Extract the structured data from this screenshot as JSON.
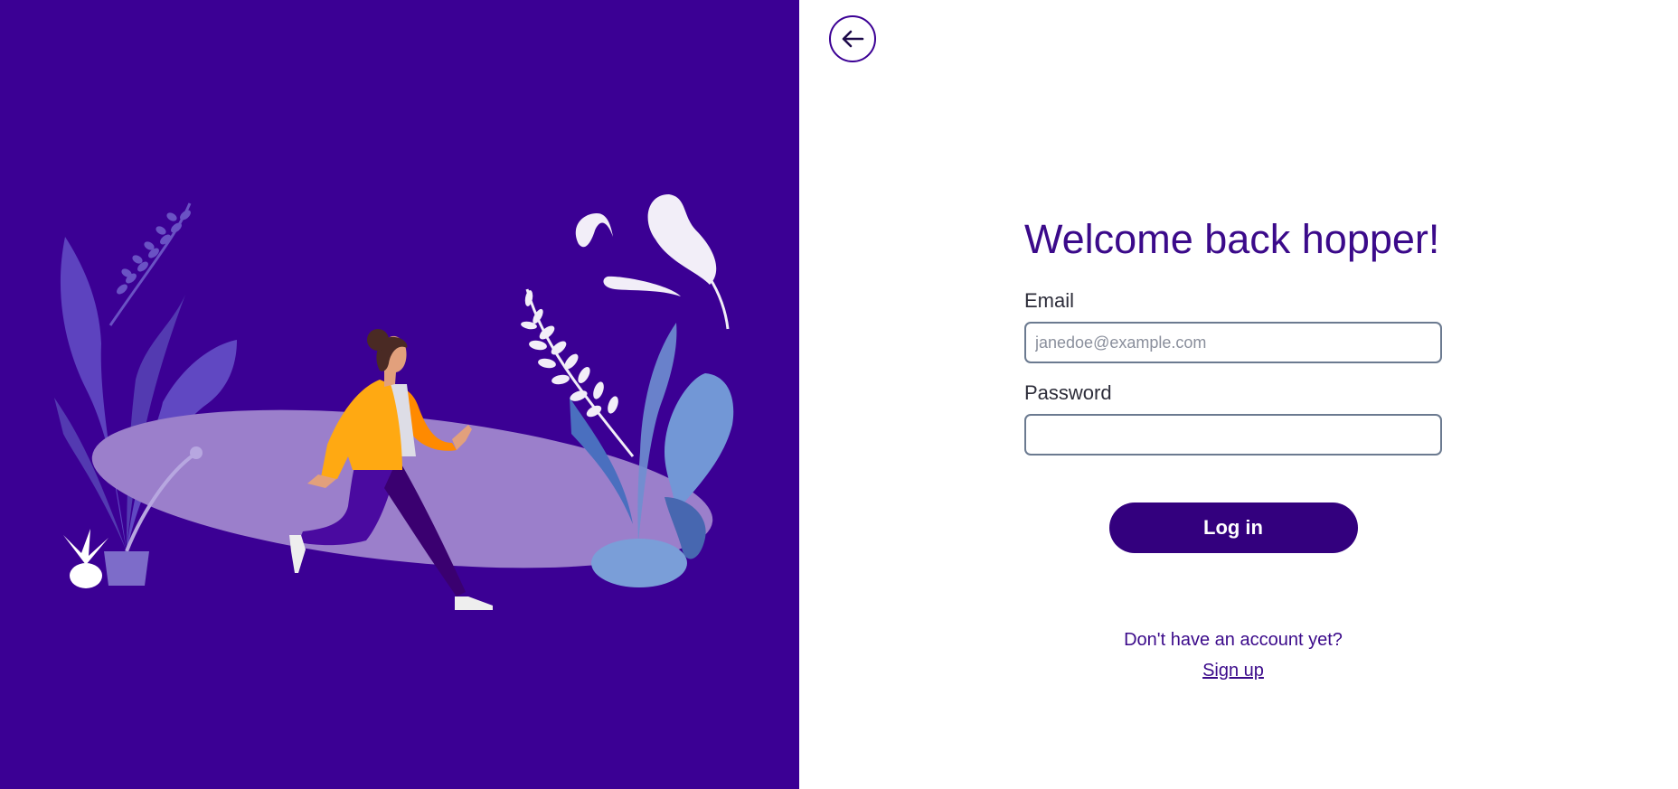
{
  "colors": {
    "brand": "#3b0094",
    "button": "#33007e",
    "title": "#3b0a8a",
    "jacket": "#ffa912",
    "leaf_white": "#f2eef8"
  },
  "illustration": {
    "icon": "woman-running-with-plants-illustration"
  },
  "header": {
    "back_icon": "arrow-left-icon"
  },
  "login": {
    "title": "Welcome back hopper!",
    "email_label": "Email",
    "email_placeholder": "janedoe@example.com",
    "email_value": "",
    "password_label": "Password",
    "password_value": "",
    "submit_label": "Log in",
    "signup_prompt": "Don't have an account yet?",
    "signup_link": "Sign up"
  }
}
